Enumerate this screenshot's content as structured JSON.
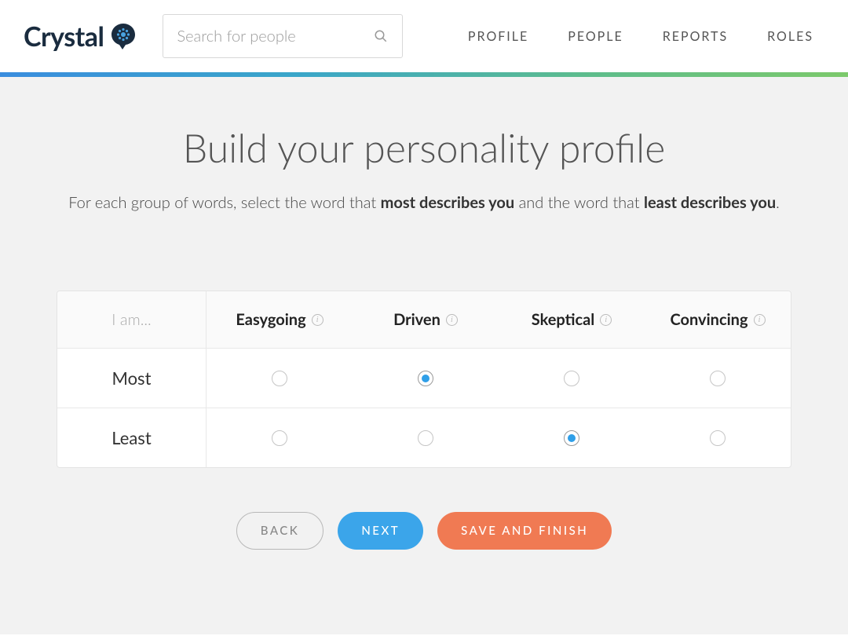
{
  "brand": {
    "name": "Crystal"
  },
  "search": {
    "placeholder": "Search for people"
  },
  "nav": {
    "profile": "PROFILE",
    "people": "PEOPLE",
    "reports": "REPORTS",
    "roles": "ROLES"
  },
  "page": {
    "title": "Build your personality profile",
    "instructions_pre": "For each group of words, select the word that ",
    "instructions_bold1": "most describes you",
    "instructions_mid": " and the word that ",
    "instructions_bold2": "least describes you",
    "instructions_post": "."
  },
  "table": {
    "iam_label": "I am...",
    "words": [
      "Easygoing",
      "Driven",
      "Skeptical",
      "Convincing"
    ],
    "rows": {
      "most": "Most",
      "least": "Least"
    },
    "selections": {
      "most_index": 1,
      "least_index": 2
    }
  },
  "buttons": {
    "back": "BACK",
    "next": "NEXT",
    "save": "SAVE AND FINISH"
  }
}
